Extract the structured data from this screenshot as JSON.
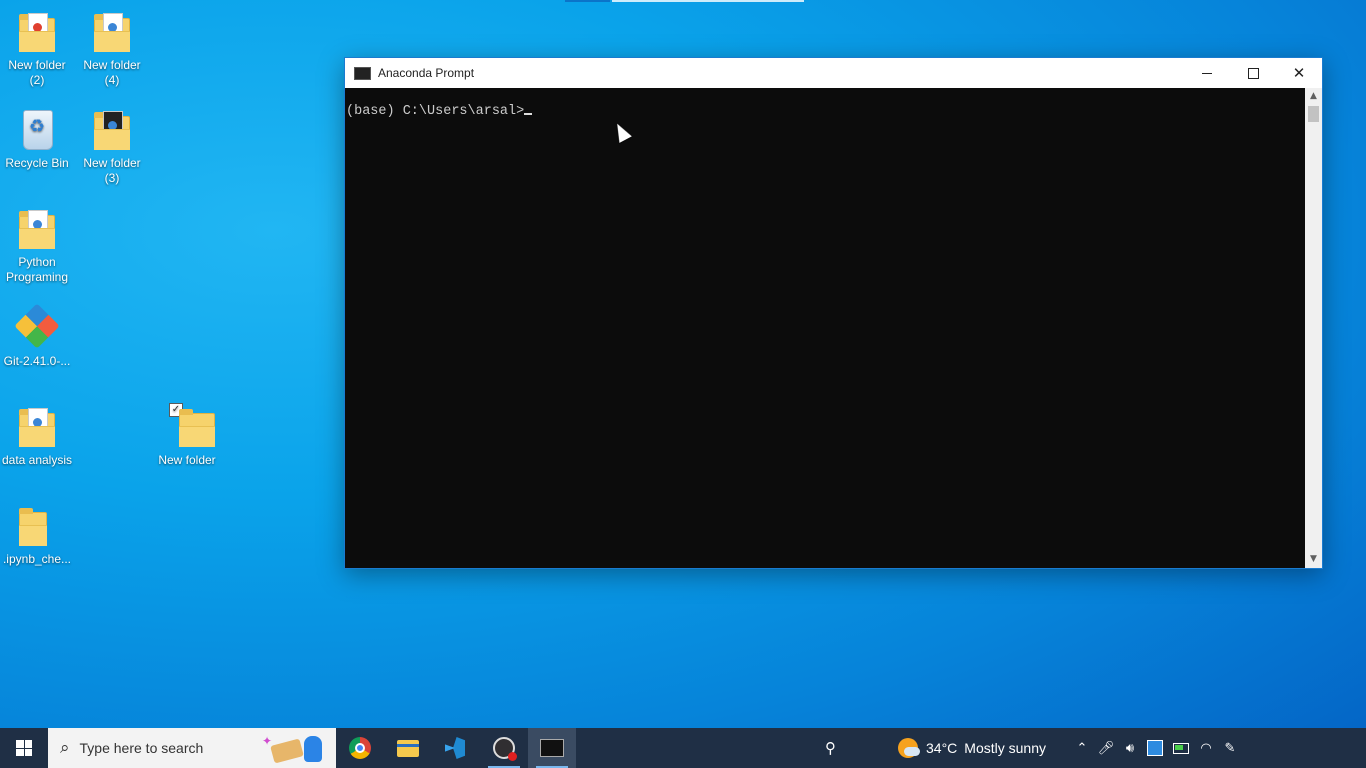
{
  "desktop": {
    "icons": [
      {
        "label": "New folder (2)"
      },
      {
        "label": "New folder (4)"
      },
      {
        "label": "Recycle Bin"
      },
      {
        "label": "New folder (3)"
      },
      {
        "label": "Python Programing"
      },
      {
        "label": "Git-2.41.0-..."
      },
      {
        "label": "data analysis"
      },
      {
        "label": "New folder"
      },
      {
        "label": ".ipynb_che..."
      }
    ]
  },
  "window": {
    "title": "Anaconda Prompt",
    "console_line": "(base) C:\\Users\\arsal>"
  },
  "taskbar": {
    "search_placeholder": "Type here to search",
    "weather_temp": "34°C",
    "weather_text": "Mostly sunny",
    "apps": [
      "chrome-icon",
      "file-explorer-icon",
      "vscode-icon",
      "obs-icon",
      "anaconda-prompt-icon"
    ]
  }
}
